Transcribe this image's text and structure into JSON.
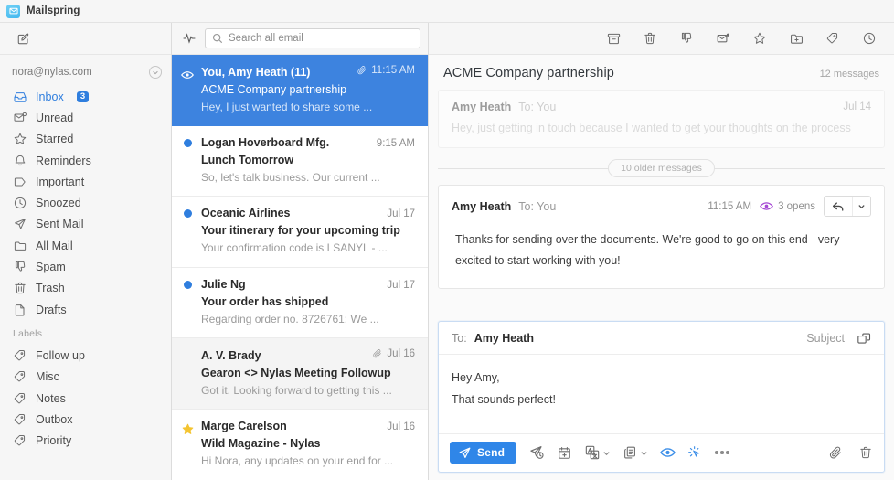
{
  "window": {
    "app_title": "Mailspring",
    "logo_icon": "mailspring-envelope-logo"
  },
  "sidebar": {
    "compose_icon": "compose-pencil-icon",
    "activity_icon": "activity-pulse-icon",
    "account_email": "nora@nylas.com",
    "account_chevron_icon": "chevron-down-icon",
    "items": [
      {
        "label": "Inbox",
        "icon": "inbox-icon",
        "badge": "3",
        "active": true
      },
      {
        "label": "Unread",
        "icon": "unread-envelope-icon",
        "badge": "",
        "active": false
      },
      {
        "label": "Starred",
        "icon": "star-icon",
        "badge": "",
        "active": false
      },
      {
        "label": "Reminders",
        "icon": "bell-icon",
        "badge": "",
        "active": false
      },
      {
        "label": "Important",
        "icon": "tag-important-icon",
        "badge": "",
        "active": false
      },
      {
        "label": "Snoozed",
        "icon": "clock-icon",
        "badge": "",
        "active": false
      },
      {
        "label": "Sent Mail",
        "icon": "paper-plane-icon",
        "badge": "",
        "active": false
      },
      {
        "label": "All Mail",
        "icon": "folder-icon",
        "badge": "",
        "active": false
      },
      {
        "label": "Spam",
        "icon": "thumbs-down-icon",
        "badge": "",
        "active": false
      },
      {
        "label": "Trash",
        "icon": "trash-icon",
        "badge": "",
        "active": false
      },
      {
        "label": "Drafts",
        "icon": "document-icon",
        "badge": "",
        "active": false
      }
    ],
    "labels_header": "Labels",
    "labels": [
      {
        "label": "Follow up",
        "icon": "label-tag-icon"
      },
      {
        "label": "Misc",
        "icon": "label-tag-icon"
      },
      {
        "label": "Notes",
        "icon": "label-tag-icon"
      },
      {
        "label": "Outbox",
        "icon": "label-tag-icon"
      },
      {
        "label": "Priority",
        "icon": "label-tag-icon"
      }
    ]
  },
  "search": {
    "placeholder": "Search all email",
    "value": "",
    "icon": "search-icon"
  },
  "mail_list": [
    {
      "from": "You, Amy Heath (11)",
      "subject": "ACME Company partnership",
      "snippet": "Hey, I just wanted to share some ...",
      "date": "11:15 AM",
      "marker": "eye",
      "attachment": true,
      "selected": true,
      "hovered": false
    },
    {
      "from": "Logan Hoverboard Mfg.",
      "subject": "Lunch Tomorrow",
      "snippet": "So, let's talk business. Our current ...",
      "date": "9:15 AM",
      "marker": "dot",
      "attachment": false,
      "selected": false,
      "hovered": false
    },
    {
      "from": "Oceanic Airlines",
      "subject": "Your itinerary for your upcoming trip",
      "snippet": "Your confirmation code is LSANYL - ...",
      "date": "Jul 17",
      "marker": "dot",
      "attachment": false,
      "selected": false,
      "hovered": false
    },
    {
      "from": "Julie Ng",
      "subject": "Your order has shipped",
      "snippet": "Regarding order no. 8726761: We ...",
      "date": "Jul 17",
      "marker": "dot",
      "attachment": false,
      "selected": false,
      "hovered": false
    },
    {
      "from": "A. V. Brady",
      "subject": "Gearon <> Nylas Meeting Followup",
      "snippet": "Got it. Looking forward to getting this ...",
      "date": "Jul 16",
      "marker": "none",
      "attachment": true,
      "selected": false,
      "hovered": true
    },
    {
      "from": "Marge Carelson",
      "subject": "Wild Magazine - Nylas",
      "snippet": "Hi Nora, any updates on your end for ...",
      "date": "Jul 16",
      "marker": "star",
      "attachment": false,
      "selected": false,
      "hovered": false
    }
  ],
  "read_toolbar": [
    {
      "icon": "archive-icon",
      "name": "archive-button"
    },
    {
      "icon": "trash-icon",
      "name": "delete-button"
    },
    {
      "icon": "thumbs-down-icon",
      "name": "mark-spam-button"
    },
    {
      "icon": "mark-unread-icon",
      "name": "mark-unread-button"
    },
    {
      "icon": "star-icon",
      "name": "star-button"
    },
    {
      "icon": "move-to-folder-icon",
      "name": "move-to-folder-button"
    },
    {
      "icon": "label-tag-icon",
      "name": "apply-label-button"
    },
    {
      "icon": "clock-icon",
      "name": "snooze-button"
    }
  ],
  "thread": {
    "subject": "ACME Company partnership",
    "message_count": "12 messages",
    "older_divider": "10 older messages",
    "collapsed_message": {
      "from": "Amy Heath",
      "to": "To: You",
      "date": "Jul 14",
      "preview": "Hey, just getting in touch because I wanted to get your thoughts on the process"
    },
    "open_message": {
      "from": "Amy Heath",
      "to": "To: You",
      "time": "11:15 AM",
      "opens": "3 opens",
      "opens_icon": "eye-open-tracking-icon",
      "reply_icon": "reply-arrow-icon",
      "reply_caret_icon": "chevron-down-icon",
      "body": "Thanks for sending over the documents. We're good to go on this end - very excited to start working with you!"
    }
  },
  "composer": {
    "to_label": "To:",
    "to_value": "Amy Heath",
    "subject_label": "Subject",
    "popout_icon": "popout-window-icon",
    "body_line1": "Hey Amy,",
    "body_line2": "That sounds perfect!",
    "send_label": "Send",
    "send_icon": "paper-plane-icon",
    "accent_color": "#2f86e8",
    "tools": [
      {
        "name": "send-later-button",
        "icon": "send-later-icon",
        "caret": false,
        "blue": false
      },
      {
        "name": "schedule-meeting-button",
        "icon": "calendar-plus-icon",
        "caret": false,
        "blue": false
      },
      {
        "name": "translate-button",
        "icon": "translate-icon",
        "caret": true,
        "blue": false
      },
      {
        "name": "templates-button",
        "icon": "templates-icon",
        "caret": true,
        "blue": false
      },
      {
        "name": "read-receipts-button",
        "icon": "eye-open-tracking-icon",
        "caret": false,
        "blue": true
      },
      {
        "name": "link-tracking-button",
        "icon": "link-tracking-cursor-icon",
        "caret": false,
        "blue": true
      },
      {
        "name": "more-options-button",
        "icon": "more-horizontal-icon",
        "caret": false,
        "blue": false
      }
    ],
    "right_tools": [
      {
        "name": "attach-file-button",
        "icon": "paperclip-icon"
      },
      {
        "name": "discard-draft-button",
        "icon": "trash-icon"
      }
    ]
  }
}
